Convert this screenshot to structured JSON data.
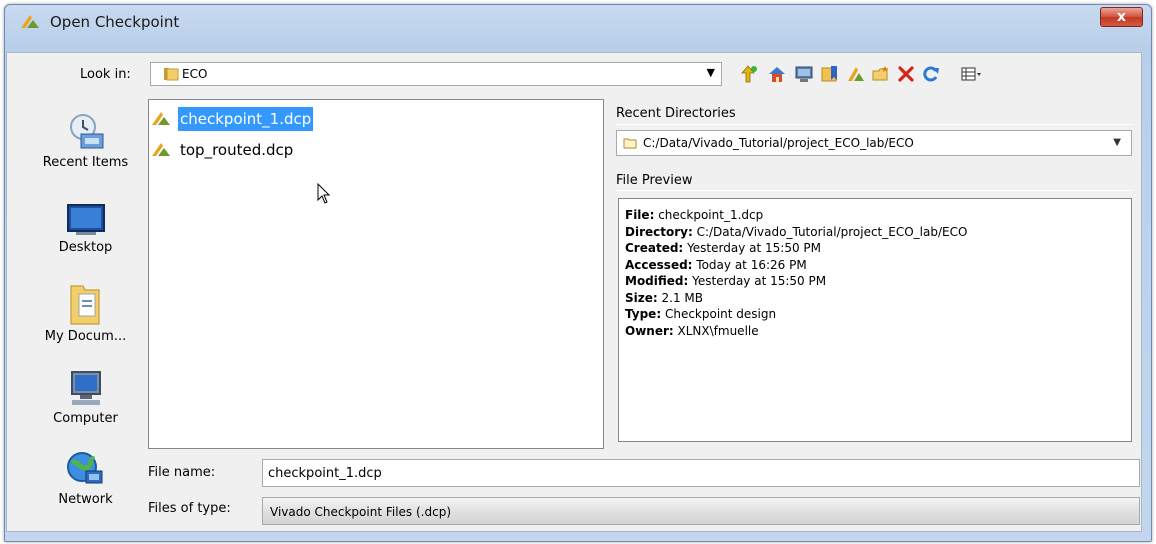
{
  "window": {
    "title": "Open Checkpoint",
    "close_label": "x"
  },
  "lookin": {
    "label": "Look in:",
    "value": "ECO"
  },
  "toolbar": {
    "icons": [
      "up-folder-icon",
      "home-icon",
      "desktop-icon",
      "bookmark-folder-icon",
      "vivado-icon",
      "new-folder-icon",
      "delete-icon",
      "refresh-icon",
      "view-menu-icon"
    ]
  },
  "places": [
    {
      "label": "Recent Items",
      "icon": "recent-items-icon"
    },
    {
      "label": "Desktop",
      "icon": "desktop-icon"
    },
    {
      "label": "My Docum...",
      "icon": "documents-icon"
    },
    {
      "label": "Computer",
      "icon": "computer-icon"
    },
    {
      "label": "Network",
      "icon": "network-icon"
    }
  ],
  "files": [
    {
      "name": "checkpoint_1.dcp",
      "selected": true
    },
    {
      "name": "top_routed.dcp",
      "selected": false
    }
  ],
  "recent_dirs": {
    "label": "Recent Directories",
    "value": "C:/Data/Vivado_Tutorial/project_ECO_lab/ECO"
  },
  "preview": {
    "label": "File Preview",
    "rows": [
      {
        "key": "File:",
        "value": "checkpoint_1.dcp"
      },
      {
        "key": "Directory:",
        "value": "C:/Data/Vivado_Tutorial/project_ECO_lab/ECO"
      },
      {
        "key": "Created:",
        "value": "Yesterday at 15:50 PM"
      },
      {
        "key": "Accessed:",
        "value": "Today at 16:26 PM"
      },
      {
        "key": "Modified:",
        "value": "Yesterday at 15:50 PM"
      },
      {
        "key": "Size:",
        "value": "2.1 MB"
      },
      {
        "key": "Type:",
        "value": "Checkpoint design"
      },
      {
        "key": "Owner:",
        "value": "XLNX\\fmuelle"
      }
    ]
  },
  "file_name": {
    "label": "File name:",
    "value": "checkpoint_1.dcp"
  },
  "file_type": {
    "label": "Files of type:",
    "value": "Vivado Checkpoint Files (.dcp)"
  },
  "colors": {
    "selection": "#3399ff",
    "title_gradient": "#c9daf0",
    "close_button": "#c13a23"
  }
}
